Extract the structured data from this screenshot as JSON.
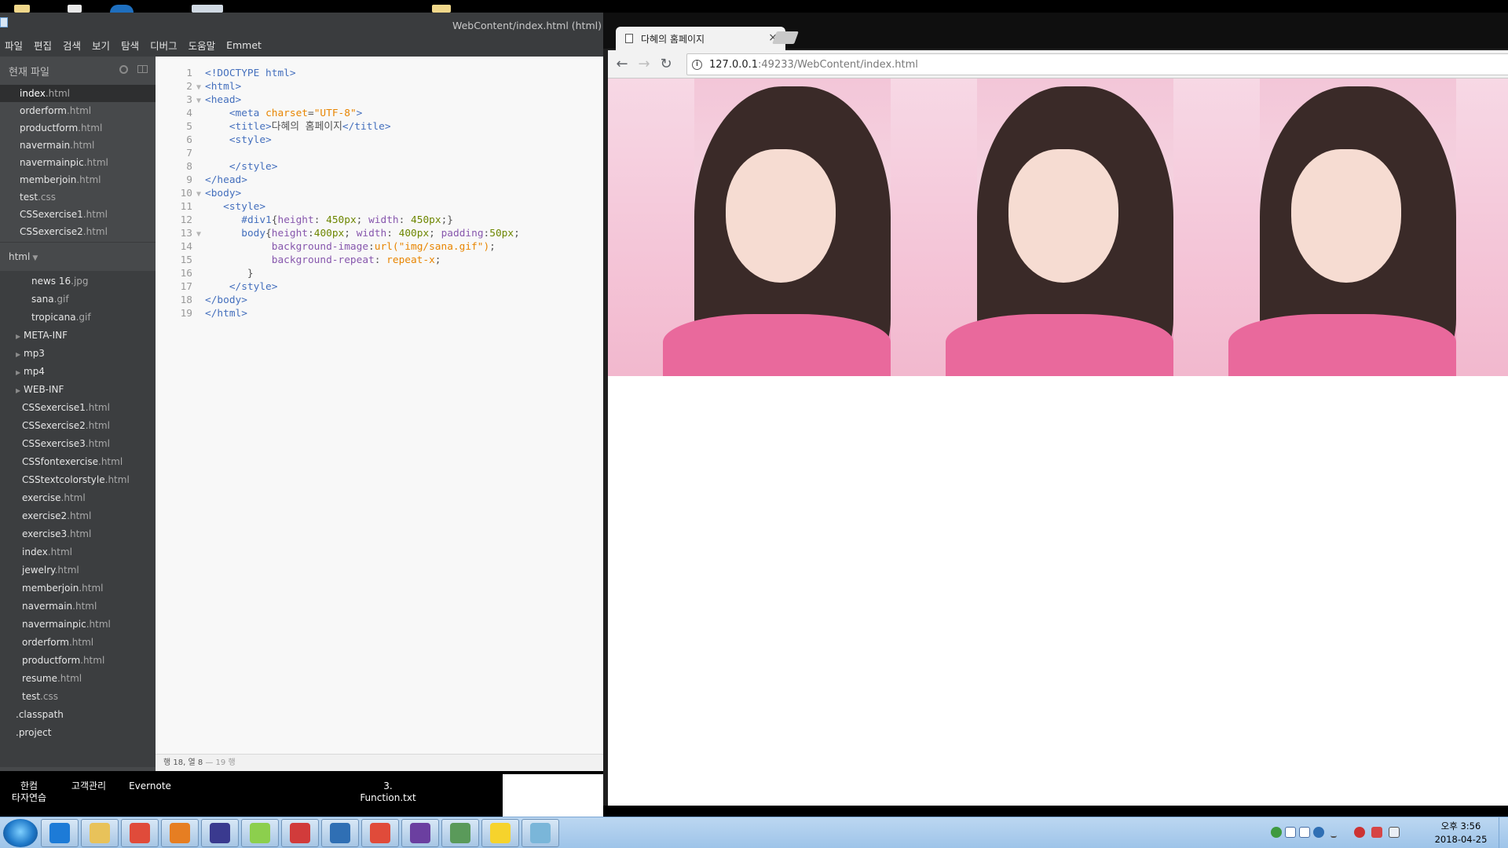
{
  "editor": {
    "title": "WebContent/index.html (html)",
    "logo_letter": "",
    "menus": [
      "파일",
      "편집",
      "검색",
      "보기",
      "탐색",
      "디버그",
      "도움말",
      "Emmet"
    ],
    "working_files_header": "현재 파일",
    "working_files": [
      {
        "name": "index",
        "ext": ".html"
      },
      {
        "name": "orderform",
        "ext": ".html"
      },
      {
        "name": "productform",
        "ext": ".html"
      },
      {
        "name": "navermain",
        "ext": ".html"
      },
      {
        "name": "navermainpic",
        "ext": ".html"
      },
      {
        "name": "memberjoin",
        "ext": ".html"
      },
      {
        "name": "test",
        "ext": ".css"
      },
      {
        "name": "CSSexercise1",
        "ext": ".html"
      },
      {
        "name": "CSSexercise2",
        "ext": ".html"
      }
    ],
    "project_name": "html",
    "tree": [
      {
        "name": "news 16",
        "ext": ".jpg",
        "indent": 2,
        "folder": false
      },
      {
        "name": "sana",
        "ext": ".gif",
        "indent": 2,
        "folder": false
      },
      {
        "name": "tropicana",
        "ext": ".gif",
        "indent": 2,
        "folder": false
      },
      {
        "name": "META-INF",
        "ext": "",
        "indent": 1,
        "folder": true
      },
      {
        "name": "mp3",
        "ext": "",
        "indent": 1,
        "folder": true
      },
      {
        "name": "mp4",
        "ext": "",
        "indent": 1,
        "folder": true
      },
      {
        "name": "WEB-INF",
        "ext": "",
        "indent": 1,
        "folder": true
      },
      {
        "name": "CSSexercise1",
        "ext": ".html",
        "indent": 1,
        "folder": false
      },
      {
        "name": "CSSexercise2",
        "ext": ".html",
        "indent": 1,
        "folder": false
      },
      {
        "name": "CSSexercise3",
        "ext": ".html",
        "indent": 1,
        "folder": false
      },
      {
        "name": "CSSfontexercise",
        "ext": ".html",
        "indent": 1,
        "folder": false
      },
      {
        "name": "CSStextcolorstyle",
        "ext": ".html",
        "indent": 1,
        "folder": false
      },
      {
        "name": "exercise",
        "ext": ".html",
        "indent": 1,
        "folder": false
      },
      {
        "name": "exercise2",
        "ext": ".html",
        "indent": 1,
        "folder": false
      },
      {
        "name": "exercise3",
        "ext": ".html",
        "indent": 1,
        "folder": false
      },
      {
        "name": "index",
        "ext": ".html",
        "indent": 1,
        "folder": false
      },
      {
        "name": "jewelry",
        "ext": ".html",
        "indent": 1,
        "folder": false
      },
      {
        "name": "memberjoin",
        "ext": ".html",
        "indent": 1,
        "folder": false
      },
      {
        "name": "navermain",
        "ext": ".html",
        "indent": 1,
        "folder": false
      },
      {
        "name": "navermainpic",
        "ext": ".html",
        "indent": 1,
        "folder": false
      },
      {
        "name": "orderform",
        "ext": ".html",
        "indent": 1,
        "folder": false
      },
      {
        "name": "productform",
        "ext": ".html",
        "indent": 1,
        "folder": false
      },
      {
        "name": "resume",
        "ext": ".html",
        "indent": 1,
        "folder": false
      },
      {
        "name": "test",
        "ext": ".css",
        "indent": 1,
        "folder": false
      },
      {
        "name": ".classpath",
        "ext": "",
        "indent": 0,
        "folder": false
      },
      {
        "name": ".project",
        "ext": "",
        "indent": 0,
        "folder": false
      }
    ],
    "code_lines": [
      {
        "n": "1",
        "fold": "",
        "parts": [
          [
            "tag",
            "<!DOCTYPE html>"
          ]
        ]
      },
      {
        "n": "2",
        "fold": "▼",
        "parts": [
          [
            "tag",
            "<html>"
          ]
        ]
      },
      {
        "n": "3",
        "fold": "▼",
        "parts": [
          [
            "tag",
            "<head>"
          ]
        ]
      },
      {
        "n": "4",
        "fold": "",
        "parts": [
          [
            "plain",
            "    "
          ],
          [
            "tag",
            "<meta "
          ],
          [
            "attr",
            "charset"
          ],
          [
            "plain",
            "="
          ],
          [
            "str",
            "\"UTF-8\""
          ],
          [
            "tag",
            ">"
          ]
        ]
      },
      {
        "n": "5",
        "fold": "",
        "parts": [
          [
            "plain",
            "    "
          ],
          [
            "tag",
            "<title>"
          ],
          [
            "plain",
            "다혜의 홈페이지"
          ],
          [
            "tag",
            "</title>"
          ]
        ]
      },
      {
        "n": "6",
        "fold": "",
        "parts": [
          [
            "plain",
            "    "
          ],
          [
            "tag",
            "<style>"
          ]
        ]
      },
      {
        "n": "7",
        "fold": "",
        "parts": [
          [
            "plain",
            ""
          ]
        ]
      },
      {
        "n": "8",
        "fold": "",
        "parts": [
          [
            "plain",
            "    "
          ],
          [
            "tag",
            "</style>"
          ]
        ]
      },
      {
        "n": "9",
        "fold": "",
        "parts": [
          [
            "tag",
            "</head>"
          ]
        ]
      },
      {
        "n": "10",
        "fold": "▼",
        "parts": [
          [
            "tag",
            "<body>"
          ]
        ]
      },
      {
        "n": "11",
        "fold": "",
        "parts": [
          [
            "plain",
            "   "
          ],
          [
            "tag",
            "<style>"
          ]
        ]
      },
      {
        "n": "12",
        "fold": "",
        "parts": [
          [
            "plain",
            "      "
          ],
          [
            "tag",
            "#div1"
          ],
          [
            "plain",
            "{"
          ],
          [
            "prop",
            "height"
          ],
          [
            "plain",
            ": "
          ],
          [
            "val",
            "450px"
          ],
          [
            "plain",
            "; "
          ],
          [
            "prop",
            "width"
          ],
          [
            "plain",
            ": "
          ],
          [
            "val",
            "450px"
          ],
          [
            "plain",
            ";}"
          ]
        ]
      },
      {
        "n": "13",
        "fold": "▼",
        "parts": [
          [
            "plain",
            "      "
          ],
          [
            "tag",
            "body"
          ],
          [
            "plain",
            "{"
          ],
          [
            "prop",
            "height"
          ],
          [
            "plain",
            ":"
          ],
          [
            "val",
            "400px"
          ],
          [
            "plain",
            "; "
          ],
          [
            "prop",
            "width"
          ],
          [
            "plain",
            ": "
          ],
          [
            "val",
            "400px"
          ],
          [
            "plain",
            "; "
          ],
          [
            "prop",
            "padding"
          ],
          [
            "plain",
            ":"
          ],
          [
            "val",
            "50px"
          ],
          [
            "plain",
            ";"
          ]
        ]
      },
      {
        "n": "14",
        "fold": "",
        "parts": [
          [
            "plain",
            "           "
          ],
          [
            "prop",
            "background-image"
          ],
          [
            "plain",
            ":"
          ],
          [
            "attr",
            "url("
          ],
          [
            "str",
            "\"img/sana.gif\""
          ],
          [
            "attr",
            ")"
          ],
          [
            "plain",
            ";"
          ]
        ]
      },
      {
        "n": "15",
        "fold": "",
        "parts": [
          [
            "plain",
            "           "
          ],
          [
            "prop",
            "background-repeat"
          ],
          [
            "plain",
            ": "
          ],
          [
            "str",
            "repeat-x"
          ],
          [
            "plain",
            ";"
          ]
        ]
      },
      {
        "n": "16",
        "fold": "",
        "parts": [
          [
            "plain",
            "       }"
          ]
        ]
      },
      {
        "n": "17",
        "fold": "",
        "parts": [
          [
            "plain",
            "    "
          ],
          [
            "tag",
            "</style>"
          ]
        ]
      },
      {
        "n": "18",
        "fold": "",
        "parts": [
          [
            "tag",
            "</body>"
          ]
        ]
      },
      {
        "n": "19",
        "fold": "",
        "parts": [
          [
            "tag",
            "</html>"
          ]
        ]
      }
    ],
    "status_position": "행 18, 열 8",
    "status_lines": " — 19 행"
  },
  "browser": {
    "tab_title": "다혜의 홈페이지",
    "tab_close": "×",
    "url_host": "127.0.0.1",
    "url_rest": ":49233/WebContent/index.html",
    "back": "←",
    "forward": "→",
    "reload": "↻",
    "info": "i"
  },
  "desktop": {
    "labels": [
      {
        "text": "한컴\n타자연습"
      },
      {
        "text": "고객관리"
      },
      {
        "text": "Evernote"
      },
      {
        "text": "3.\nFunction.txt"
      }
    ]
  },
  "taskbar": {
    "apps": [
      "ie",
      "explorer",
      "chrome",
      "media-player",
      "eclipse",
      "notes",
      "snipping",
      "brackets",
      "chrome",
      "java-ee-ide",
      "git",
      "kakaotalk",
      "notepad"
    ],
    "app_colors": [
      "#1d7bd7",
      "#e8c25a",
      "#e04b3a",
      "#e67e22",
      "#3a3a8f",
      "#8ccf4d",
      "#d13b3b",
      "#2f6fb4",
      "#e04b3a",
      "#6b3fa0",
      "#5a9a5a",
      "#f6d32c",
      "#7ab6d9"
    ],
    "clock_time": "오후 3:56",
    "clock_date": "2018-04-25"
  }
}
